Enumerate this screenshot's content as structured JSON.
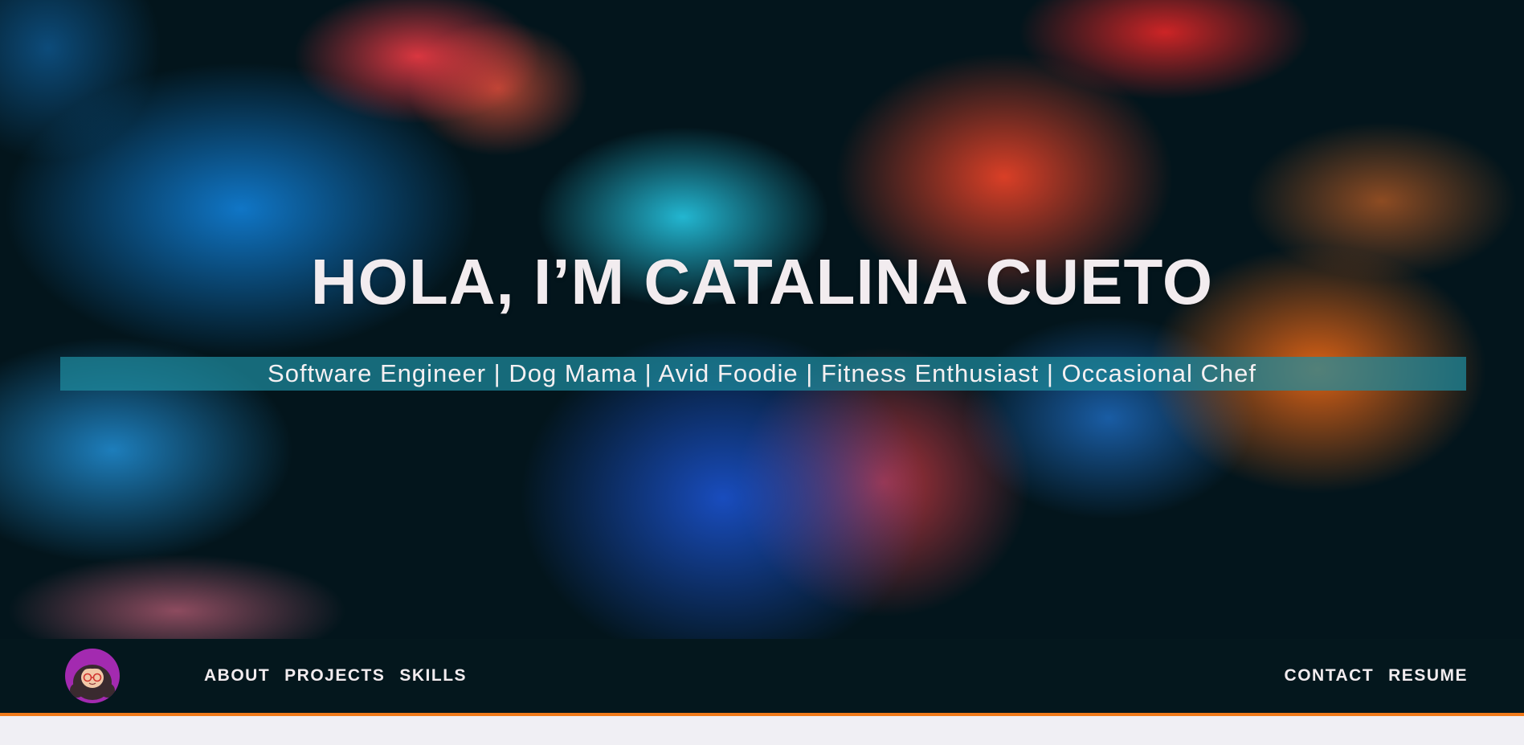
{
  "hero": {
    "title": "HOLA, I’M CATALINA CUETO",
    "subtitle": "Software Engineer | Dog Mama | Avid Foodie | Fitness Enthusiast | Occasional Chef"
  },
  "navbar": {
    "avatar_icon": "cartoon-avatar-icon",
    "left_links": [
      "ABOUT",
      "PROJECTS",
      "SKILLS"
    ],
    "right_links": [
      "CONTACT",
      "RESUME"
    ]
  },
  "colors": {
    "nav_background": "#04171d",
    "nav_border": "#f07a1a",
    "subtitle_band": "#1e8ca0",
    "avatar_ring": "#a32ab0",
    "page_background": "#f0eff4"
  }
}
